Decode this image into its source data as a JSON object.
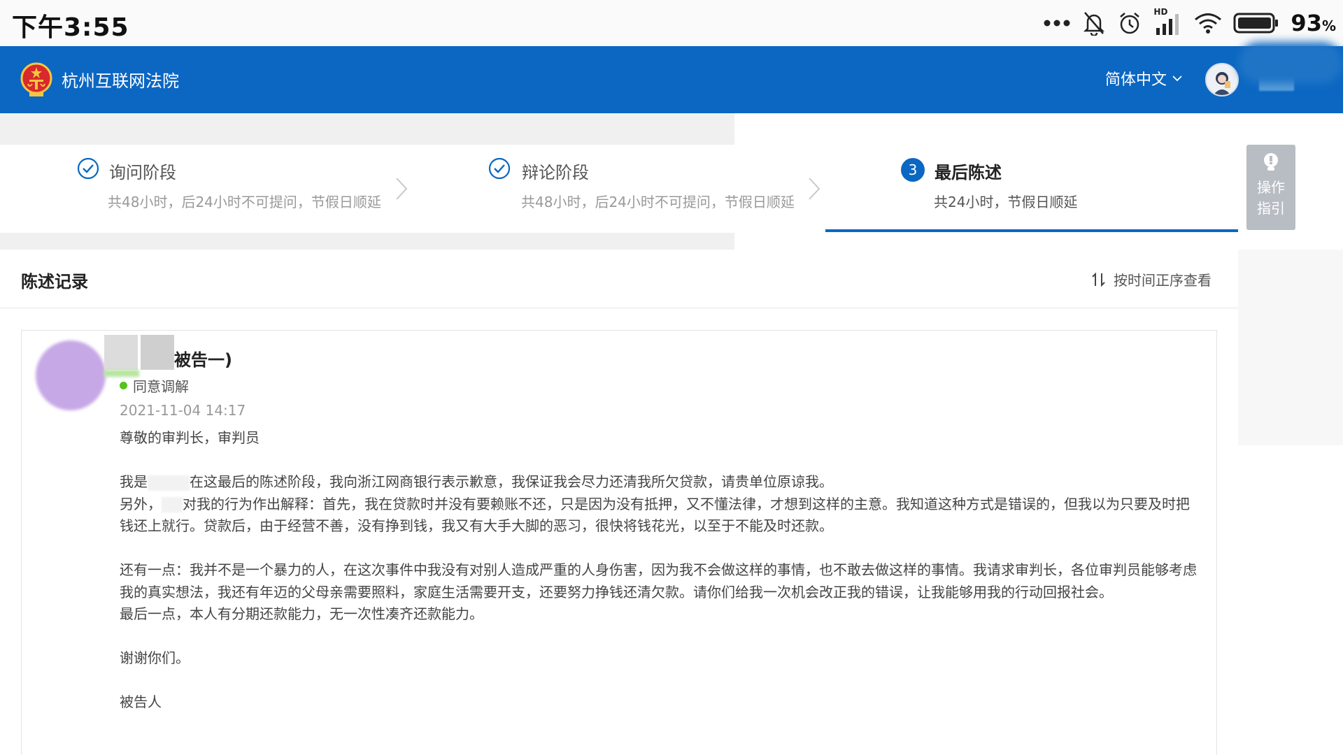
{
  "status_bar": {
    "time": "下午3:55",
    "network_label": "HD",
    "battery_percent": "93",
    "battery_unit": "%",
    "icons": [
      "more-dots-icon",
      "bell-muted-icon",
      "alarm-icon",
      "signal-icon",
      "wifi-icon",
      "battery-icon"
    ]
  },
  "header": {
    "court_name": "杭州互联网法院",
    "language": "简体中文",
    "colors": {
      "brand": "#0b67c2"
    }
  },
  "steps": [
    {
      "title": "询问阶段",
      "subtitle": "共48小时，后24小时不可提问，节假日顺延",
      "state": "done"
    },
    {
      "title": "辩论阶段",
      "subtitle": "共48小时，后24小时不可提问，节假日顺延",
      "state": "done"
    },
    {
      "number": "3",
      "title": "最后陈述",
      "subtitle": "共24小时，节假日顺延",
      "state": "active"
    }
  ],
  "guide": {
    "label": "操作指引"
  },
  "records": {
    "title": "陈述记录",
    "sort_label": "按时间正序查看",
    "entry": {
      "party": "被告一)",
      "mediation_status": "同意调解",
      "time": "2021-11-04 14:17",
      "greeting": "尊敬的审判长，审判员",
      "p1_a": "我是",
      "p1_b": "在这最后的陈述阶段，我向浙江网商银行表示歉意，我保证我会尽力还清我所欠贷款，请贵单位原谅我。",
      "p2_a": "另外，",
      "p2_b": "对我的行为作出解释：首先，我在贷款时并没有要赖账不还，只是因为没有抵押，又不懂法律，才想到这样的主意。我知道这种方式是错误的，但我以为只要及时把钱还上就行。贷款后，由于经营不善，没有挣到钱，我又有大手大脚的恶习，很快将钱花光，以至于不能及时还款。",
      "p3": "还有一点：我并不是一个暴力的人，在这次事件中我没有对别人造成严重的人身伤害，因为我不会做这样的事情，也不敢去做这样的事情。我请求审判长，各位审判员能够考虑我的真实想法，我还有年迈的父母亲需要照料，家庭生活需要开支，还要努力挣钱还清欠款。请你们给我一次机会改正我的错误，让我能够用我的行动回报社会。",
      "p4": "最后一点，本人有分期还款能力，无一次性凑齐还款能力。",
      "thanks": "谢谢你们。",
      "signature": "被告人"
    }
  }
}
